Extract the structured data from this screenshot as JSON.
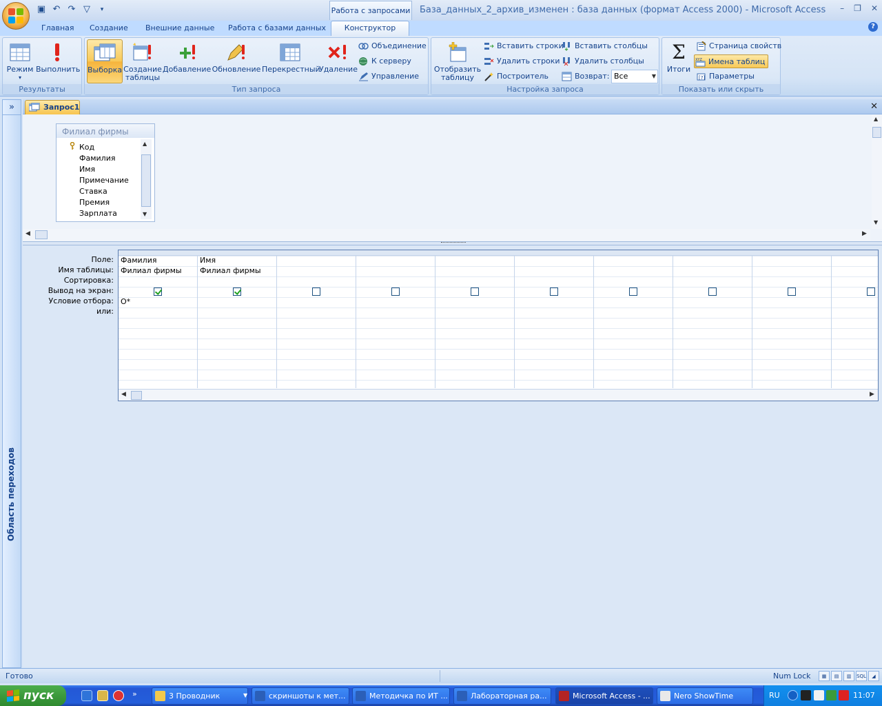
{
  "window": {
    "title": "База_данных_2_архив_изменен : база данных (формат Access 2000) - Microsoft Access",
    "context_tab_title": "Работа с запросами"
  },
  "ribbon": {
    "tabs": [
      "Главная",
      "Создание",
      "Внешние данные",
      "Работа с базами данных",
      "Конструктор"
    ],
    "active_tab": "Конструктор",
    "groups": {
      "results": {
        "label": "Результаты",
        "mode_label": "Режим",
        "run_label": "Выполнить"
      },
      "query_type": {
        "label": "Тип запроса",
        "select_label": "Выборка",
        "make_table_label_1": "Создание",
        "make_table_label_2": "таблицы",
        "append_label": "Добавление",
        "update_label": "Обновление",
        "crosstab_label": "Перекрестный",
        "delete_label": "Удаление",
        "union_label": "Объединение",
        "passthrough_label": "К серверу",
        "ddl_label": "Управление"
      },
      "query_setup": {
        "label": "Настройка запроса",
        "show_table_label_1": "Отобразить",
        "show_table_label_2": "таблицу",
        "insert_rows_label": "Вставить строки",
        "delete_rows_label": "Удалить строки",
        "builder_label": "Построитель",
        "insert_columns_label": "Вставить столбцы",
        "delete_columns_label": "Удалить столбцы",
        "return_label": "Возврат:",
        "return_value": "Все"
      },
      "show_hide": {
        "label": "Показать или скрыть",
        "totals_label": "Итоги",
        "property_sheet_label": "Страница свойств",
        "table_names_label": "Имена таблиц",
        "parameters_label": "Параметры"
      }
    }
  },
  "nav_pane": {
    "label": "Область переходов",
    "toggle": "»"
  },
  "document": {
    "tab_label": "Запрос1",
    "close": "✕"
  },
  "field_list": {
    "title": "Филиал фирмы",
    "fields": [
      "Код",
      "Фамилия",
      "Имя",
      "Примечание",
      "Ставка",
      "Премия",
      "Зарплата"
    ]
  },
  "design_grid": {
    "row_labels": [
      "Поле:",
      "Имя таблицы:",
      "Сортировка:",
      "Вывод на экран:",
      "Условие отбора:",
      "или:"
    ],
    "columns": [
      {
        "field": "Фамилия",
        "table": "Филиал фирмы",
        "show": true,
        "criteria": "O*"
      },
      {
        "field": "Имя",
        "table": "Филиал фирмы",
        "show": true,
        "criteria": ""
      },
      {
        "field": "",
        "table": "",
        "show": false,
        "criteria": ""
      },
      {
        "field": "",
        "table": "",
        "show": false,
        "criteria": ""
      },
      {
        "field": "",
        "table": "",
        "show": false,
        "criteria": ""
      },
      {
        "field": "",
        "table": "",
        "show": false,
        "criteria": ""
      },
      {
        "field": "",
        "table": "",
        "show": false,
        "criteria": ""
      },
      {
        "field": "",
        "table": "",
        "show": false,
        "criteria": ""
      },
      {
        "field": "",
        "table": "",
        "show": false,
        "criteria": ""
      },
      {
        "field": "",
        "table": "",
        "show": false,
        "criteria": ""
      }
    ]
  },
  "status_bar": {
    "status": "Готово",
    "numlock": "Num Lock"
  },
  "taskbar": {
    "start_label": "пуск",
    "buttons": [
      {
        "label": "3 Проводник",
        "icon": "folder-icon",
        "color": "#f2c94c"
      },
      {
        "label": "скриншоты к мет...",
        "icon": "word-doc-icon",
        "color": "#2b5fb8"
      },
      {
        "label": "Методичка по ИТ ...",
        "icon": "word-doc-icon",
        "color": "#2b5fb8"
      },
      {
        "label": "Лабораторная ра...",
        "icon": "word-doc-icon",
        "color": "#2b5fb8"
      },
      {
        "label": "Microsoft Access - ...",
        "icon": "access-icon",
        "color": "#b32424"
      },
      {
        "label": "Nero ShowTime",
        "icon": "nero-icon",
        "color": "#e9e9e9"
      }
    ],
    "language": "RU",
    "clock": "11:07"
  }
}
